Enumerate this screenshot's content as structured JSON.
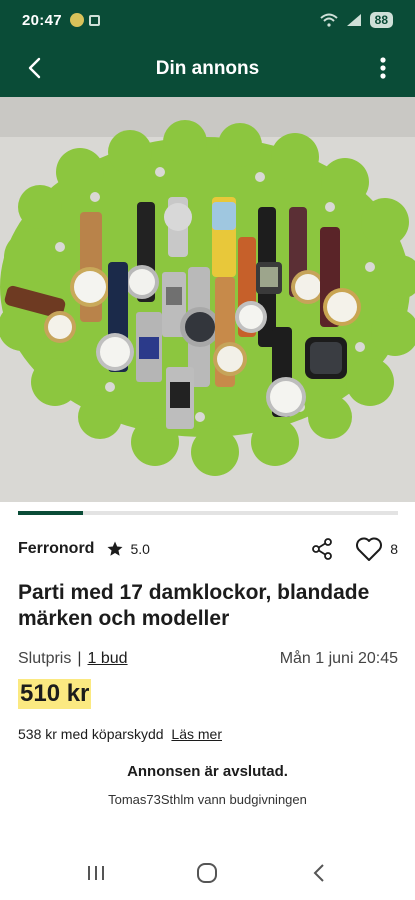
{
  "status_bar": {
    "time": "20:47",
    "battery": "88"
  },
  "app_bar": {
    "title": "Din annons"
  },
  "gallery": {
    "image_description": "Many ladies' wristwatches laid out on a green felt doily",
    "progress": 0.17
  },
  "seller": {
    "name": "Ferronord",
    "rating": "5.0",
    "favorites": "8"
  },
  "item": {
    "title": "Parti med 17 damklockor, blandade märken och modeller"
  },
  "auction": {
    "status_label": "Slutpris",
    "bids": "1 bud",
    "end_date": "Mån 1 juni 20:45",
    "price": "510 kr",
    "protection_text": "538 kr med köparskydd",
    "protection_link": "Läs mer",
    "ended_text": "Annonsen är avslutad.",
    "winner_text": "Tomas73Sthlm vann budgivningen"
  },
  "colors": {
    "brand_green": "#0a4c37",
    "price_highlight": "#fbe981",
    "felt_green": "#8cc63f"
  }
}
